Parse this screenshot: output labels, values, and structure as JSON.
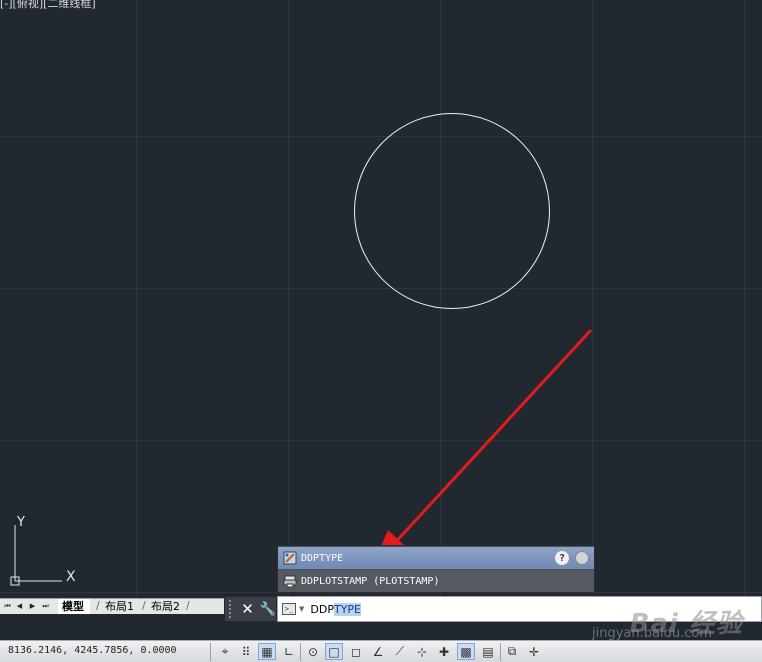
{
  "viewport": {
    "label": "[-][俯视][二维线框]"
  },
  "ucs": {
    "x_label": "X",
    "y_label": "Y"
  },
  "autocomplete": {
    "items": [
      {
        "label": "DDPTYPE",
        "icon": "point-style-icon",
        "selected": true
      },
      {
        "label": "DDPLOTSTAMP (PLOTSTAMP)",
        "icon": "plot-stamp-icon",
        "selected": false
      }
    ],
    "help_icon": "?"
  },
  "layout_tabs": {
    "tabs": [
      {
        "label": "模型",
        "active": true
      },
      {
        "label": "布局1",
        "active": false
      },
      {
        "label": "布局2",
        "active": false
      }
    ]
  },
  "command_line": {
    "typed": "DDP",
    "suggestion": "TYPE",
    "close_glyph": "✕",
    "custom_glyph": "🔧"
  },
  "watermark": {
    "brand": "Bai 经验",
    "url": "jingyan.baidu.com"
  },
  "status_bar": {
    "coordinates": "8136.2146, 4245.7856, 0.0000"
  },
  "colors": {
    "canvas_bg": "#212830",
    "arrow": "#e21b1b",
    "circle": "#f2f2f2",
    "selection": "#7f97c0"
  }
}
